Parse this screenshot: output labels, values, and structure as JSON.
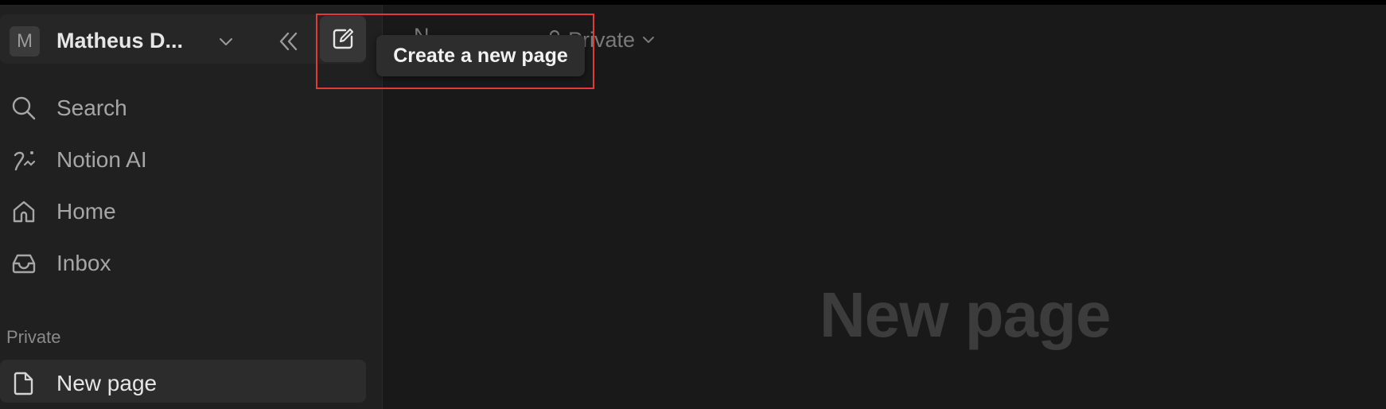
{
  "workspace": {
    "avatar_letter": "M",
    "name": "Matheus D..."
  },
  "sidebar": {
    "nav_items": [
      {
        "label": "Search",
        "icon": "search-icon"
      },
      {
        "label": "Notion AI",
        "icon": "notion-ai-icon"
      },
      {
        "label": "Home",
        "icon": "home-icon"
      },
      {
        "label": "Inbox",
        "icon": "inbox-icon"
      }
    ],
    "section_label": "Private",
    "pages": [
      {
        "label": "New page",
        "icon": "page-icon",
        "selected": true
      }
    ]
  },
  "tooltip": {
    "text": "Create a new page"
  },
  "breadcrumb": {
    "page_label": "N",
    "privacy_label": "Private"
  },
  "main": {
    "page_title": "New page"
  },
  "colors": {
    "background": "#191919",
    "sidebar": "#202020",
    "highlight": "#e53935"
  }
}
